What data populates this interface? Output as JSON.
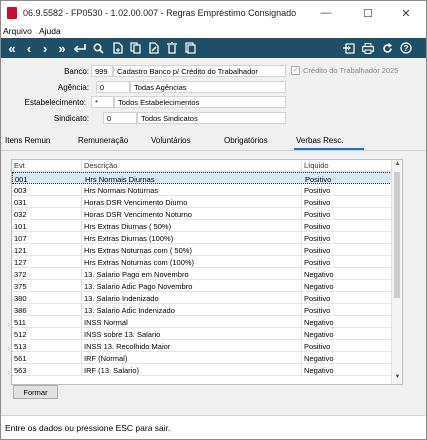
{
  "window": {
    "title": "06.9.5582 - FP0530 - 1.02.00.007 - Regras Empréstimo Consignado",
    "minimize": "—",
    "maximize": "☐",
    "close": "✕"
  },
  "menu": [
    "Arquivo",
    "Ajuda"
  ],
  "toolbar": {
    "icons": [
      "first-icon",
      "previous-icon",
      "next-icon",
      "last-icon",
      "return-icon",
      "search-icon",
      "new-icon",
      "copy-icon",
      "edit-icon",
      "delete-icon",
      "save-icon",
      "export-icon",
      "print-icon",
      "refresh-icon",
      "help-icon"
    ]
  },
  "form": {
    "banco_label": "Banco:",
    "banco_code": "999",
    "banco_name": "Cadastro Banco p/ Crédito do Trabalhador",
    "agencia_label": "Agência:",
    "agencia_code": "0",
    "agencia_name": "Todas Agências",
    "estab_label": "Estabelecimento:",
    "estab_code": "*",
    "estab_name": "Todos Estabelecimentos",
    "sindicato_label": "Sindicato:",
    "sindicato_code": "0",
    "sindicato_name": "Todos Sindicatos",
    "credito_label": "Crédito do Trabalhador 2025",
    "credito_checked": true
  },
  "tabs": [
    "Itens Remun",
    "Remuneração",
    "Voluntários",
    "Obrigatórios",
    "Verbas Resc."
  ],
  "active_tab": 4,
  "grid": {
    "headers": [
      "Evt",
      "Descrição",
      "Líquido"
    ],
    "rows": [
      [
        "001",
        "Hrs Normais Diurnas",
        "Positivo"
      ],
      [
        "003",
        "Hrs Normais Noturnas",
        "Positivo"
      ],
      [
        "031",
        "Horas DSR Vencimento Diurno",
        "Positivo"
      ],
      [
        "032",
        "Horas DSR Vencimento Noturno",
        "Positivo"
      ],
      [
        "101",
        "Hrs Extras Diurnas ( 50%)",
        "Positivo"
      ],
      [
        "107",
        "Hrs Extras Diurnas (100%)",
        "Positivo"
      ],
      [
        "121",
        "Hrs Extras Noturnas com ( 50%)",
        "Positivo"
      ],
      [
        "127",
        "Hrs Extras Noturnas com (100%)",
        "Positivo"
      ],
      [
        "372",
        "13. Salario Pago em Novembro",
        "Negativo"
      ],
      [
        "375",
        "13. Salario Adic Pago Novembro",
        "Negativo"
      ],
      [
        "380",
        "13. Salario Indenizado",
        "Positivo"
      ],
      [
        "386",
        "13. Salario Adic Indenizado",
        "Positivo"
      ],
      [
        "511",
        "INSS Normal",
        "Negativo"
      ],
      [
        "512",
        "INSS sobre 13. Salario",
        "Negativo"
      ],
      [
        "513",
        "INSS 13. Recolhido Maior",
        "Positivo"
      ],
      [
        "561",
        "IRF (Normal)",
        "Negativo"
      ],
      [
        "563",
        "IRF (13. Salario)",
        "Negativo"
      ]
    ]
  },
  "formar_button": "Formar",
  "status": "Entre os dados ou pressione ESC para sair."
}
